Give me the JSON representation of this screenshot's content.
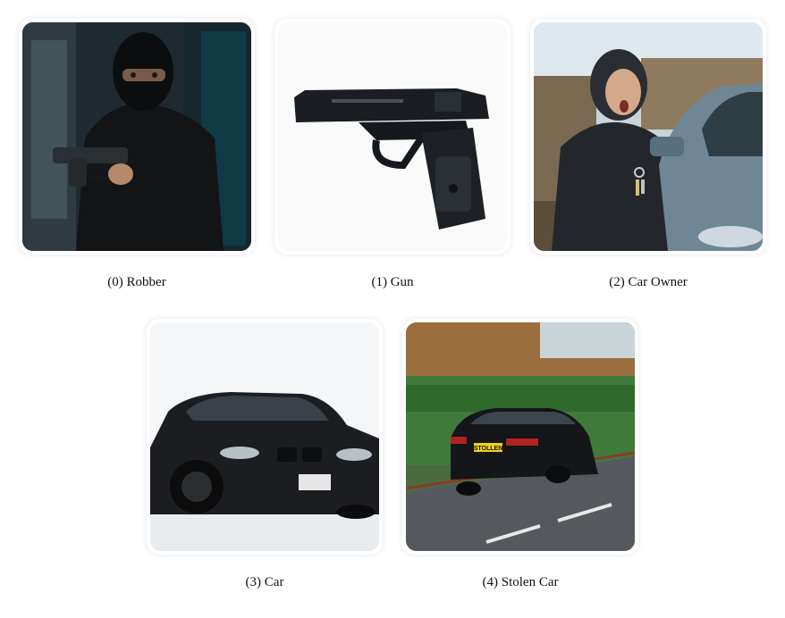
{
  "items": [
    {
      "index": "(0)",
      "label": "Robber",
      "caption": "(0) Robber",
      "icon": "robber-image"
    },
    {
      "index": "(1)",
      "label": "Gun",
      "caption": "(1) Gun",
      "icon": "gun-image"
    },
    {
      "index": "(2)",
      "label": "Car Owner",
      "caption": "(2) Car Owner",
      "icon": "car-owner-image"
    },
    {
      "index": "(3)",
      "label": "Car",
      "caption": "(3) Car",
      "icon": "car-image"
    },
    {
      "index": "(4)",
      "label": "Stolen Car",
      "caption": "(4) Stolen Car",
      "icon": "stolen-car-image"
    }
  ],
  "plate_text": "STOLLEN"
}
